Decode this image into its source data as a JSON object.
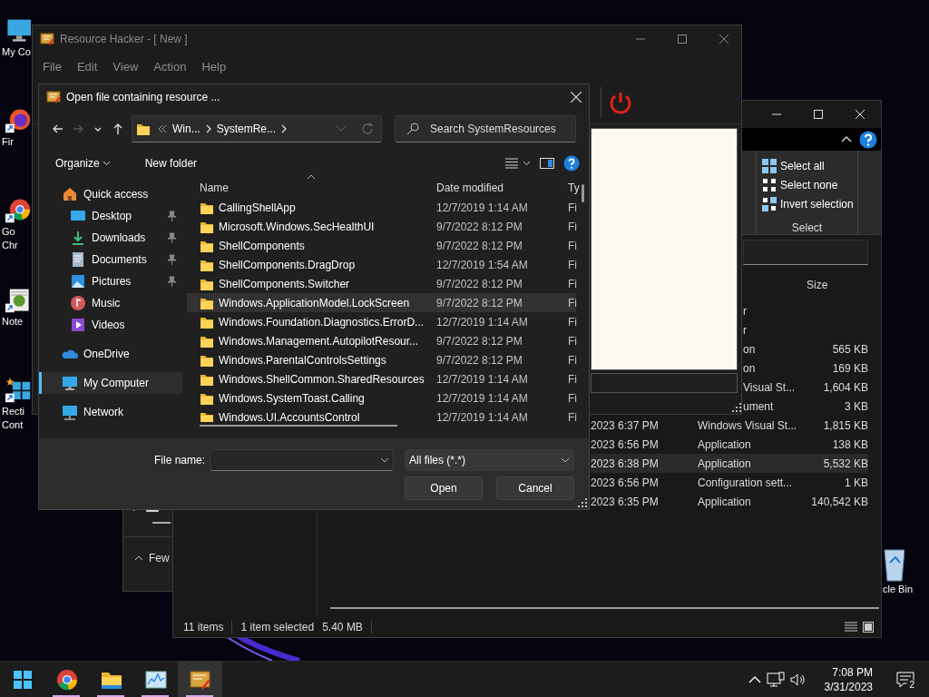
{
  "desktop": {
    "icons": [
      {
        "kind": "computer",
        "lines": [
          "My Co"
        ]
      },
      {
        "kind": "firefox",
        "lines": [
          "Fir"
        ]
      },
      {
        "kind": "chrome",
        "lines": [
          "Go",
          "Chr"
        ]
      },
      {
        "kind": "notepad",
        "lines": [
          "Note"
        ]
      },
      {
        "kind": "rectangle",
        "lines": [
          "Recti",
          "Cont"
        ]
      }
    ],
    "recycle_bin": {
      "lines": [
        "cle Bin"
      ]
    }
  },
  "back_window": {
    "label": "Few"
  },
  "explorer": {
    "select_group": {
      "items": [
        {
          "label": "Select all",
          "kind": "all"
        },
        {
          "label": "Select none",
          "kind": "none"
        },
        {
          "label": "Invert selection",
          "kind": "invert"
        }
      ],
      "label": "Select"
    },
    "columns": [
      "Size"
    ],
    "partial_rows": [
      {
        "type": "r",
        "selected": false
      },
      {
        "type": "r",
        "selected": false
      },
      {
        "type": "on",
        "size": "565 KB",
        "selected": false
      },
      {
        "type": "on",
        "size": "169 KB",
        "selected": false
      },
      {
        "type": "Visual St...",
        "size": "1,604 KB",
        "selected": false
      },
      {
        "type": "ument",
        "size": "3 KB",
        "selected": false
      }
    ],
    "rows": [
      {
        "date": "2023 6:37 PM",
        "type": "Windows Visual St...",
        "size": "1,815 KB",
        "selected": false
      },
      {
        "date": "2023 6:56 PM",
        "type": "Application",
        "size": "138 KB",
        "selected": false
      },
      {
        "date": "2023 6:38 PM",
        "type": "Application",
        "size": "5,532 KB",
        "selected": true
      },
      {
        "date": "2023 6:56 PM",
        "type": "Configuration sett...",
        "size": "1 KB",
        "selected": false
      },
      {
        "date": "2023 6:35 PM",
        "type": "Application",
        "size": "140,542 KB",
        "selected": false
      }
    ],
    "status": {
      "count": "11 items",
      "selection": "1 item selected",
      "size": "5.40 MB"
    }
  },
  "resource_hacker": {
    "title": "Resource Hacker - [ New ]",
    "menu": [
      "File",
      "Edit",
      "View",
      "Action",
      "Help"
    ]
  },
  "open_dialog": {
    "title": "Open file containing resource ...",
    "breadcrumb": [
      "Win...",
      "SystemRe..."
    ],
    "search": {
      "placeholder": "Search SystemResources"
    },
    "toolbar": [
      {
        "label": "Organize",
        "kind": "menu"
      },
      {
        "label": "New folder",
        "kind": "plain"
      }
    ],
    "nav": [
      {
        "label": "Quick access",
        "kind": "quick",
        "selected": false,
        "children": [
          {
            "label": "Desktop",
            "kind": "desktop",
            "pinned": true,
            "selected": false
          },
          {
            "label": "Downloads",
            "kind": "downloads",
            "pinned": true,
            "selected": false
          },
          {
            "label": "Documents",
            "kind": "documents",
            "pinned": true,
            "selected": false
          },
          {
            "label": "Pictures",
            "kind": "pictures",
            "pinned": true,
            "selected": false
          },
          {
            "label": "Music",
            "kind": "music",
            "pinned": false,
            "selected": false
          },
          {
            "label": "Videos",
            "kind": "videos",
            "pinned": false,
            "selected": false
          }
        ]
      },
      {
        "label": "OneDrive",
        "kind": "onedrive",
        "selected": false
      },
      {
        "label": "My Computer",
        "kind": "computer",
        "selected": true
      },
      {
        "label": "Network",
        "kind": "network",
        "selected": false
      }
    ],
    "columns": [
      "Name",
      "Date modified",
      "Ty"
    ],
    "files": [
      {
        "name": "CallingShellApp",
        "date": "12/7/2019 1:14 AM",
        "type": "Fi",
        "selected": false,
        "hovered": false
      },
      {
        "name": "Microsoft.Windows.SecHealthUI",
        "date": "9/7/2022 8:12 PM",
        "type": "Fi",
        "selected": false,
        "hovered": false
      },
      {
        "name": "ShellComponents",
        "date": "9/7/2022 8:12 PM",
        "type": "Fi",
        "selected": false,
        "hovered": false
      },
      {
        "name": "ShellComponents.DragDrop",
        "date": "12/7/2019 1:54 AM",
        "type": "Fi",
        "selected": false,
        "hovered": false
      },
      {
        "name": "ShellComponents.Switcher",
        "date": "9/7/2022 8:12 PM",
        "type": "Fi",
        "selected": false,
        "hovered": false
      },
      {
        "name": "Windows.ApplicationModel.LockScreen",
        "date": "9/7/2022 8:12 PM",
        "type": "Fi",
        "selected": false,
        "hovered": true
      },
      {
        "name": "Windows.Foundation.Diagnostics.ErrorD...",
        "date": "12/7/2019 1:14 AM",
        "type": "Fi",
        "selected": false,
        "hovered": false
      },
      {
        "name": "Windows.Management.AutopilotResour...",
        "date": "9/7/2022 8:12 PM",
        "type": "Fi",
        "selected": false,
        "hovered": false
      },
      {
        "name": "Windows.ParentalControlsSettings",
        "date": "9/7/2022 8:12 PM",
        "type": "Fi",
        "selected": false,
        "hovered": false
      },
      {
        "name": "Windows.ShellCommon.SharedResources",
        "date": "12/7/2019 1:14 AM",
        "type": "Fi",
        "selected": false,
        "hovered": false
      },
      {
        "name": "Windows.SystemToast.Calling",
        "date": "12/7/2019 1:14 AM",
        "type": "Fi",
        "selected": false,
        "hovered": false
      },
      {
        "name": "Windows.UI.AccountsControl",
        "date": "12/7/2019 1:14 AM",
        "type": "Fi",
        "selected": false,
        "hovered": false
      }
    ],
    "file_name": {
      "label": "File name:"
    },
    "filter": "All files (*.*)",
    "buttons": [
      "Open",
      "Cancel"
    ]
  },
  "taskbar": {
    "items": [
      {
        "kind": "start",
        "running": false,
        "selected": false
      },
      {
        "kind": "chrome",
        "running": true,
        "selected": false
      },
      {
        "kind": "folder",
        "running": true,
        "selected": false
      },
      {
        "kind": "monitor",
        "running": true,
        "selected": false
      },
      {
        "kind": "resource",
        "running": true,
        "selected": true
      }
    ],
    "time": "7:08 PM",
    "date": "3/31/2023",
    "notifications": "2"
  }
}
